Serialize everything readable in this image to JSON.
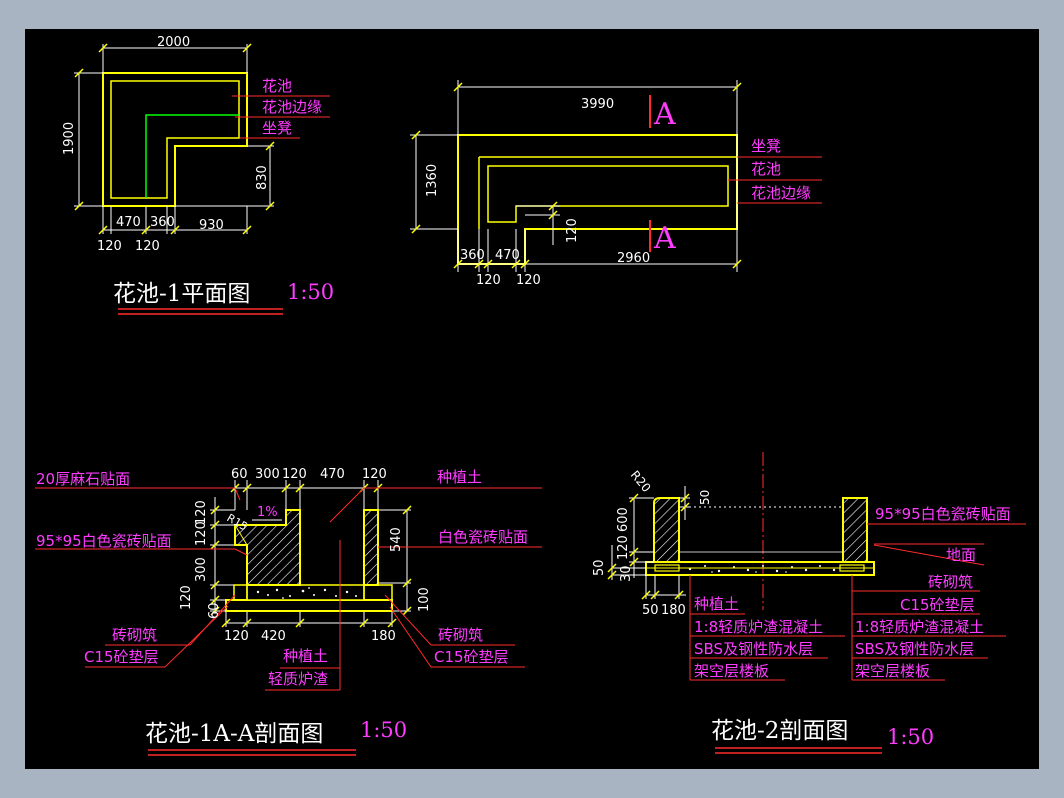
{
  "colors": {
    "background": "#000000",
    "frame": "#a9b4c2",
    "outline": "#ffff00",
    "annotation": "#ff3cff",
    "green_line": "#00ff00",
    "leader_red": "#ff2b2b",
    "dimension": "#ffffff"
  },
  "plan1": {
    "title": "花池-1平面图",
    "scale": "1:50",
    "dims": {
      "top": "2000",
      "left": "1900",
      "right": "830",
      "b1": "470",
      "b2": "360",
      "b3": "930",
      "b4": "120",
      "b5": "120"
    },
    "labels": [
      "花池",
      "花池边缘",
      "坐凳"
    ]
  },
  "plan2": {
    "dims": {
      "top": "3990",
      "left": "1360",
      "right": "120",
      "b1": "360",
      "b2": "470",
      "b3": "2960",
      "b4": "120",
      "b5": "120"
    },
    "labels": [
      "坐凳",
      "花池",
      "花池边缘"
    ],
    "section_mark": "A"
  },
  "section1": {
    "title": "花池-1A-A剖面图",
    "scale": "1:50",
    "top_dims": [
      "60",
      "300",
      "120",
      "470",
      "120"
    ],
    "left_dims": [
      "120",
      "120",
      "300",
      "120",
      "60"
    ],
    "right_dims": [
      "540",
      "100"
    ],
    "bottom_dims": [
      "120",
      "420",
      "180"
    ],
    "slope": "1%",
    "radius": "R15",
    "labels": {
      "finish_top": "20厚麻石贴面",
      "tile_left": "95*95白色瓷砖贴面",
      "soil_top": "种植土",
      "tile_right": "白色瓷砖贴面",
      "brick_left": "砖砌筑",
      "c15_left": "C15砼垫层",
      "soil_bottom": "种植土",
      "slag": "轻质炉渣",
      "brick_right": "砖砌筑",
      "c15_right": "C15砼垫层"
    }
  },
  "section2": {
    "title": "花池-2剖面图",
    "scale": "1:50",
    "radius": "R20",
    "left_dims": [
      "600",
      "120",
      "50",
      "30"
    ],
    "top_dim": "50",
    "bottom_dims": [
      "50",
      "180"
    ],
    "labels": {
      "tile": "95*95白色瓷砖贴面",
      "ground": "地面",
      "brick": "砖砌筑",
      "c15": "C15砼垫层",
      "layers_left": [
        "种植土",
        "1:8轻质炉渣混凝土",
        "SBS及钢性防水层",
        "架空层楼板"
      ],
      "layers_right": [
        "1:8轻质炉渣混凝土",
        "SBS及钢性防水层",
        "架空层楼板"
      ]
    }
  }
}
